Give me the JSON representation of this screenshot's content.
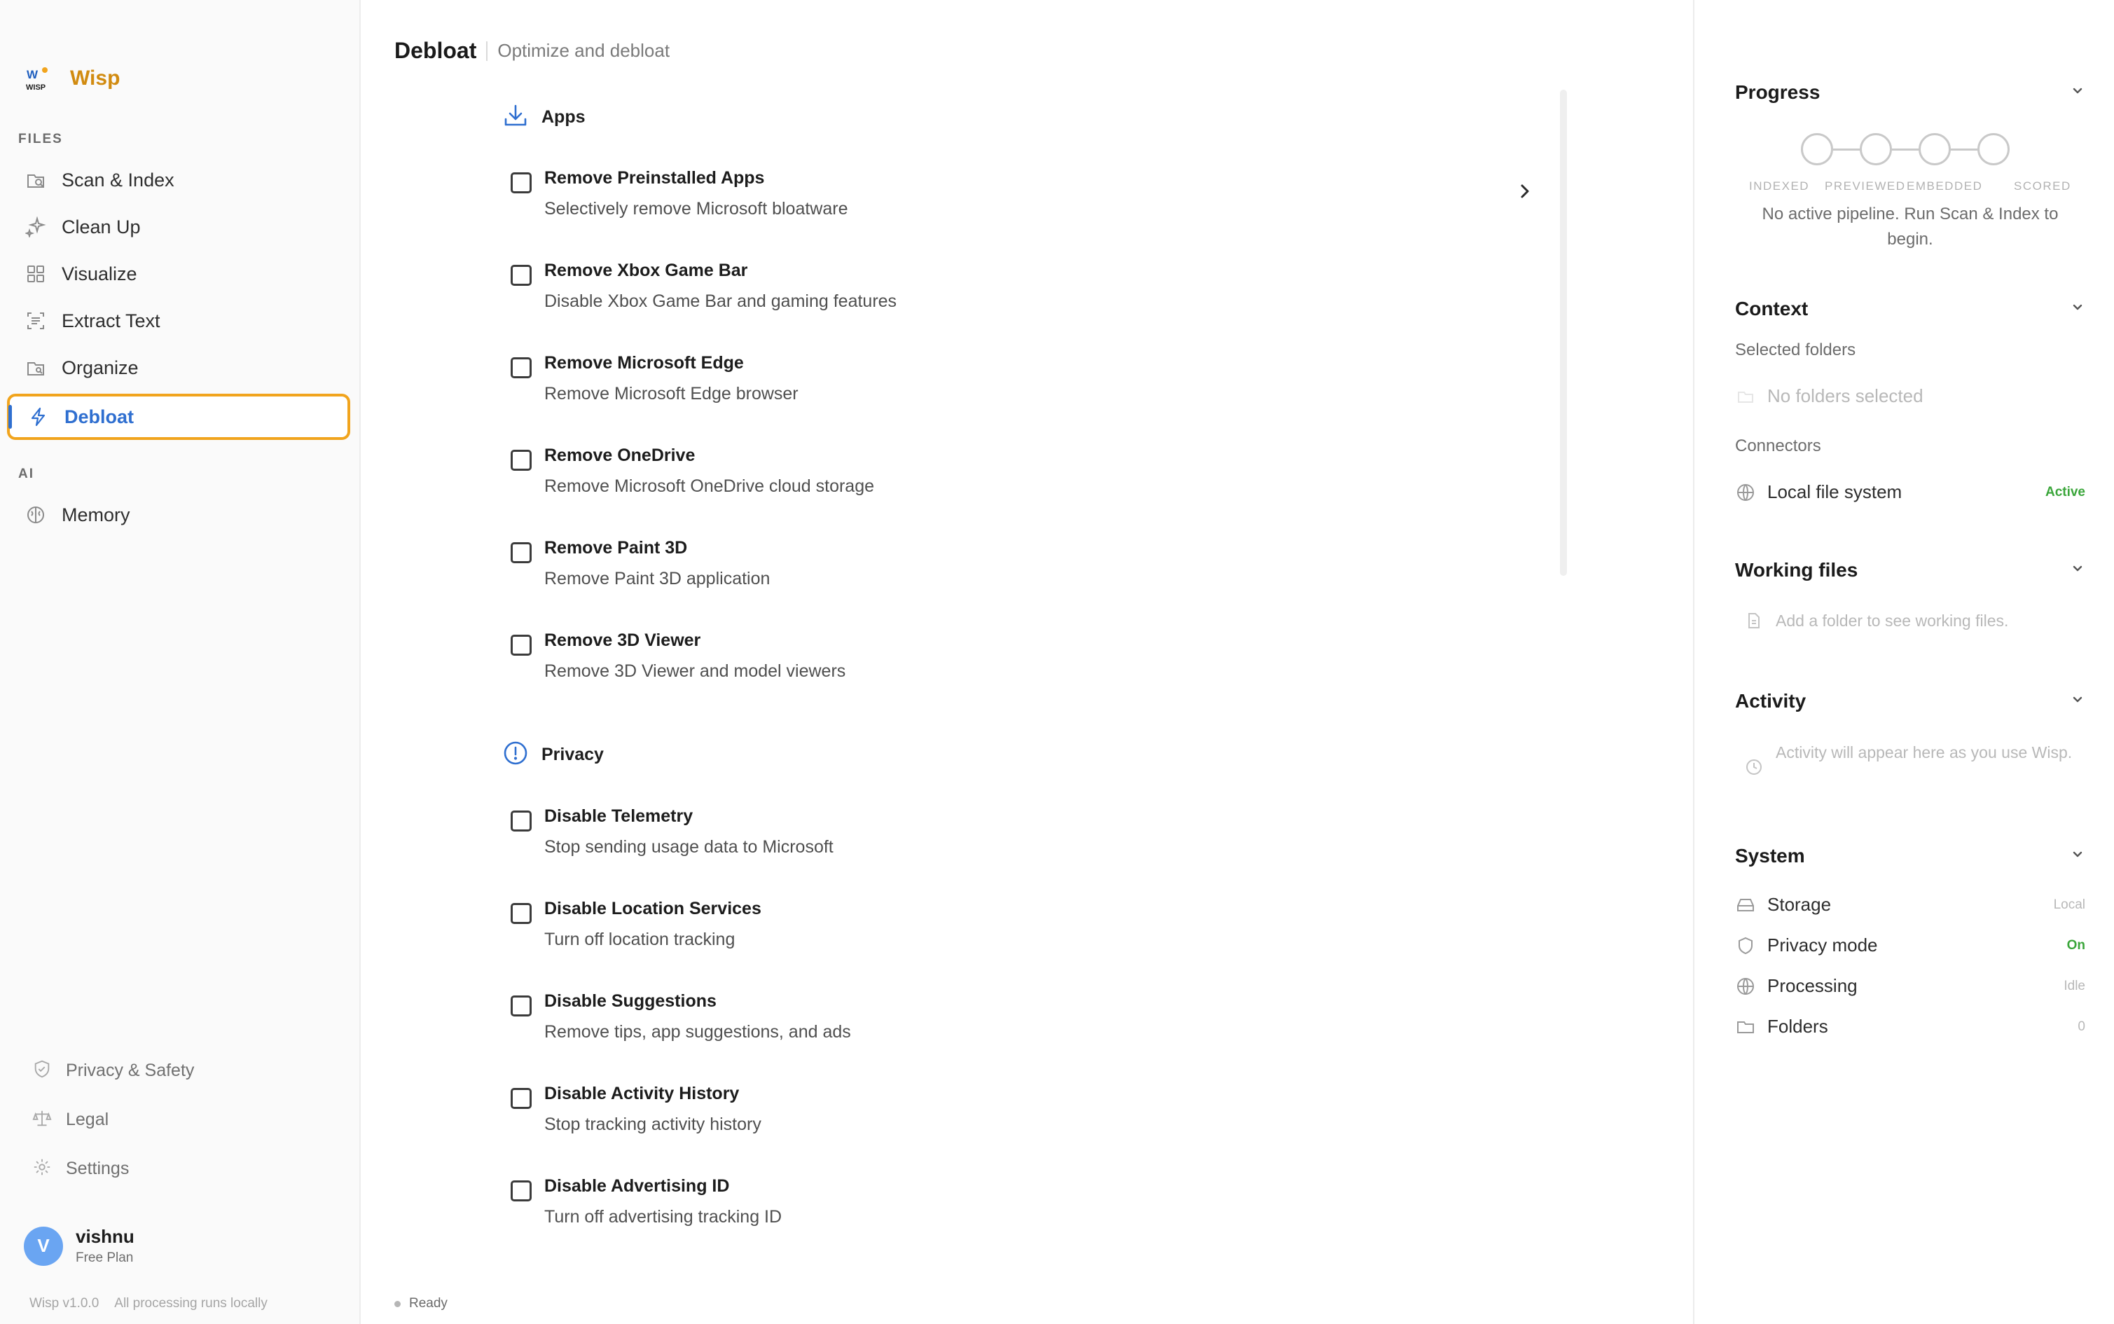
{
  "app": {
    "name": "Wisp",
    "version": "Wisp v1.0.0",
    "tagline": "All processing runs locally",
    "logo_text": "WISP"
  },
  "colors": {
    "accent": "#2f6fd0",
    "brand": "#d18b10",
    "highlight": "#f1a41d",
    "success": "#3ba63b"
  },
  "sidebar": {
    "files_label": "FILES",
    "ai_label": "AI",
    "items": [
      {
        "label": "Scan & Index",
        "icon": "scan-icon"
      },
      {
        "label": "Clean Up",
        "icon": "sparkle-icon"
      },
      {
        "label": "Visualize",
        "icon": "grid-icon"
      },
      {
        "label": "Extract Text",
        "icon": "text-scan-icon"
      },
      {
        "label": "Organize",
        "icon": "folder-search-icon"
      },
      {
        "label": "Debloat",
        "icon": "lightning-icon",
        "active": true
      }
    ],
    "ai_items": [
      {
        "label": "Memory",
        "icon": "brain-icon"
      }
    ],
    "footer": [
      {
        "label": "Privacy & Safety",
        "icon": "shield-icon"
      },
      {
        "label": "Legal",
        "icon": "scale-icon"
      },
      {
        "label": "Settings",
        "icon": "gear-icon"
      }
    ],
    "user": {
      "initial": "V",
      "name": "vishnu",
      "plan": "Free Plan"
    }
  },
  "main": {
    "title": "Debloat",
    "subtitle": "Optimize and debloat",
    "status": "Ready",
    "groups": [
      {
        "label": "Apps",
        "icon": "download-icon",
        "options": [
          {
            "title": "Remove Preinstalled Apps",
            "desc": "Selectively remove Microsoft bloatware",
            "checked": false
          },
          {
            "title": "Remove Xbox Game Bar",
            "desc": "Disable Xbox Game Bar and gaming features",
            "checked": false
          },
          {
            "title": "Remove Microsoft Edge",
            "desc": "Remove Microsoft Edge browser",
            "checked": false
          },
          {
            "title": "Remove OneDrive",
            "desc": "Remove Microsoft OneDrive cloud storage",
            "checked": false
          },
          {
            "title": "Remove Paint 3D",
            "desc": "Remove Paint 3D application",
            "checked": false
          },
          {
            "title": "Remove 3D Viewer",
            "desc": "Remove 3D Viewer and model viewers",
            "checked": false
          }
        ]
      },
      {
        "label": "Privacy",
        "icon": "alert-circle-icon",
        "options": [
          {
            "title": "Disable Telemetry",
            "desc": "Stop sending usage data to Microsoft",
            "checked": false
          },
          {
            "title": "Disable Location Services",
            "desc": "Turn off location tracking",
            "checked": false
          },
          {
            "title": "Disable Suggestions",
            "desc": "Remove tips, app suggestions, and ads",
            "checked": false
          },
          {
            "title": "Disable Activity History",
            "desc": "Stop tracking activity history",
            "checked": false
          },
          {
            "title": "Disable Advertising ID",
            "desc": "Turn off advertising tracking ID",
            "checked": false
          }
        ]
      }
    ]
  },
  "right": {
    "progress": {
      "title": "Progress",
      "steps": [
        "INDEXED",
        "PREVIEWED",
        "EMBEDDED",
        "SCORED"
      ],
      "message": "No active pipeline. Run Scan & Index to begin."
    },
    "context": {
      "title": "Context",
      "folders_label": "Selected folders",
      "folders_empty": "No folders selected",
      "connectors_label": "Connectors",
      "connector": {
        "label": "Local file system",
        "status": "Active",
        "icon": "globe-icon"
      }
    },
    "working_files": {
      "title": "Working files",
      "empty": "Add a folder to see working files.",
      "icon": "file-icon"
    },
    "activity": {
      "title": "Activity",
      "empty": "Activity will appear here as you use Wisp.",
      "icon": "clock-icon"
    },
    "system": {
      "title": "System",
      "rows": [
        {
          "label": "Storage",
          "value": "Local",
          "icon": "drive-icon"
        },
        {
          "label": "Privacy mode",
          "value": "On",
          "icon": "shield-icon"
        },
        {
          "label": "Processing",
          "value": "Idle",
          "icon": "globe-icon"
        },
        {
          "label": "Folders",
          "value": "0",
          "icon": "folder-icon"
        }
      ]
    }
  }
}
